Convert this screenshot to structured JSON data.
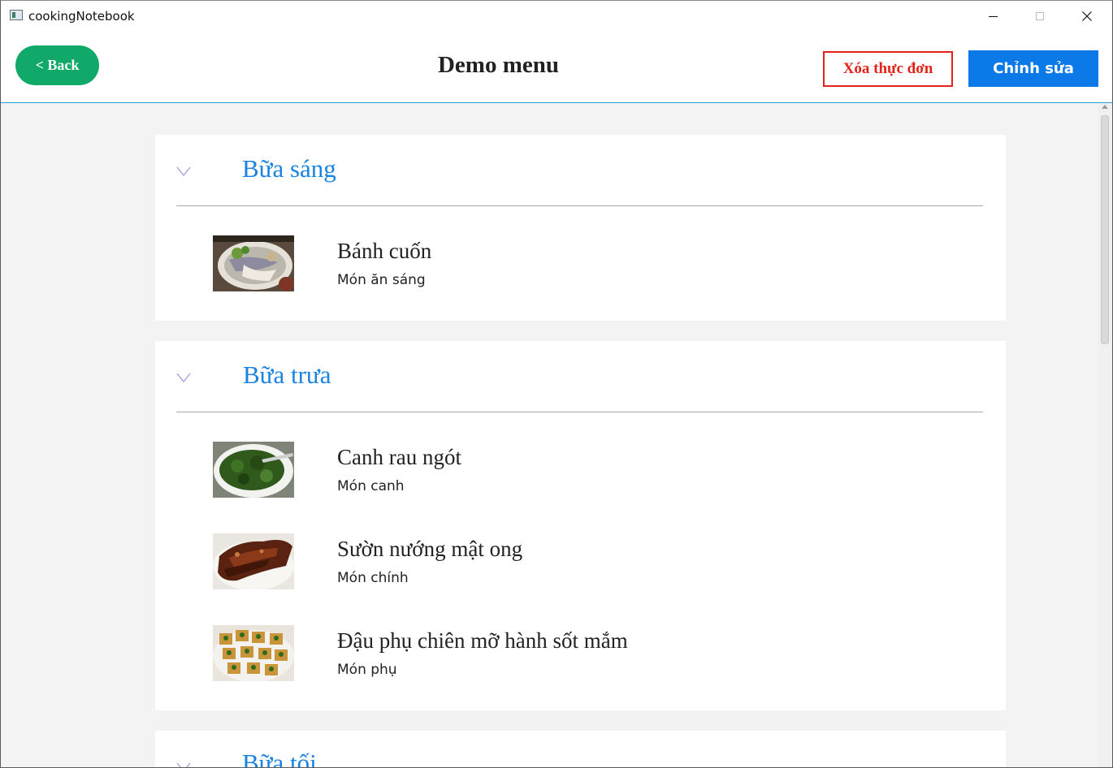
{
  "window": {
    "title": "cookingNotebook"
  },
  "header": {
    "back_label": "< Back",
    "title": "Demo menu",
    "delete_label": "Xóa thực đơn",
    "edit_label": "Chỉnh sửa"
  },
  "colors": {
    "back_button": "#11a96a",
    "delete_button": "#e2231a",
    "edit_button": "#0c79e8",
    "section_title": "#1a82e0",
    "header_border": "#1d9fd8"
  },
  "sections": [
    {
      "title": "Bữa sáng",
      "dishes": [
        {
          "name": "Bánh cuốn",
          "type": "Món ăn sáng",
          "image": "banh-cuon-photo"
        }
      ]
    },
    {
      "title": "Bữa trưa",
      "dishes": [
        {
          "name": "Canh rau ngót",
          "type": "Món canh",
          "image": "canh-rau-ngot-photo"
        },
        {
          "name": "Sườn nướng mật ong",
          "type": "Món chính",
          "image": "suon-nuong-photo"
        },
        {
          "name": "Đậu phụ chiên mỡ hành sốt mắm",
          "type": "Món phụ",
          "image": "dau-phu-photo"
        }
      ]
    },
    {
      "title": "Bữa tối",
      "dishes": []
    }
  ]
}
